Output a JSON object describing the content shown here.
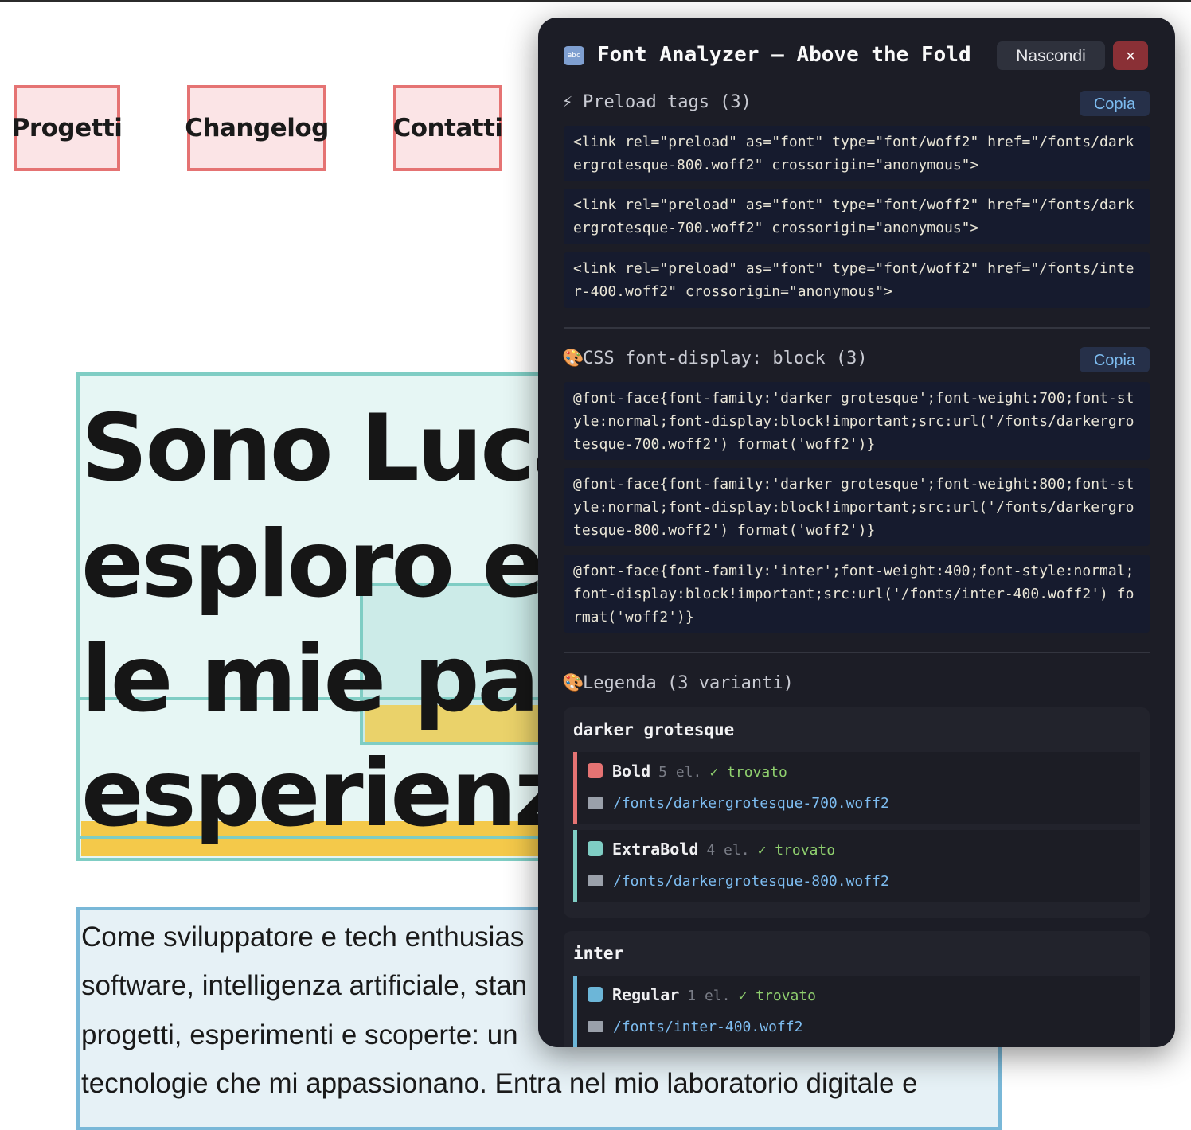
{
  "nav": {
    "items": [
      {
        "label": "Progetti"
      },
      {
        "label": "Changelog"
      },
      {
        "label": "Contatti"
      }
    ]
  },
  "hero": {
    "lines": [
      "Sono Luca",
      "esploro e c",
      "le mie pass",
      "esperienze"
    ]
  },
  "paragraph": {
    "lines": [
      "Come sviluppatore e tech enthusias",
      "software, intelligenza artificiale, stan",
      "progetti, esperimenti e scoperte: un",
      "tecnologie che mi appassionano. Entra nel mio laboratorio digitale e"
    ]
  },
  "panel": {
    "icon_text": "abc",
    "title": "Font Analyzer — Above the Fold",
    "hide_label": "Nascondi",
    "close_label": "×",
    "preload": {
      "title": "Preload tags (3)",
      "copy_label": "Copia",
      "icon": "lightning-icon",
      "tags": [
        {
          "l1": "<link rel=\"preload\" as=\"font\" type=\"font/woff2\" href=\"/fonts/dark",
          "l2": "ergrotesque-800.woff2\" crossorigin=\"anonymous\">"
        },
        {
          "l1": "<link rel=\"preload\" as=\"font\" type=\"font/woff2\" href=\"/fonts/dark",
          "l2": "ergrotesque-700.woff2\" crossorigin=\"anonymous\">"
        },
        {
          "l1": "<link rel=\"preload\" as=\"font\" type=\"font/woff2\" href=\"/fonts/inte",
          "l2": "r-400.woff2\" crossorigin=\"anonymous\">"
        }
      ]
    },
    "css": {
      "title": "CSS font-display: block (3)",
      "copy_label": "Copia",
      "icon": "palette-icon",
      "rules": [
        {
          "l1": "@font-face{font-family:'darker grotesque';font-weight:700;font-st",
          "l2": "yle:normal;font-display:block!important;src:url('/fonts/darkergro",
          "l3": "tesque-700.woff2') format('woff2')}"
        },
        {
          "l1": "@font-face{font-family:'darker grotesque';font-weight:800;font-st",
          "l2": "yle:normal;font-display:block!important;src:url('/fonts/darkergro",
          "l3": "tesque-800.woff2') format('woff2')}"
        },
        {
          "l1": "@font-face{font-family:'inter';font-weight:400;font-style:normal;",
          "l2": "font-display:block!important;src:url('/fonts/inter-400.woff2') fo",
          "l3": "rmat('woff2')}"
        }
      ]
    },
    "legend": {
      "title": "Legenda (3 varianti)",
      "icon": "palette-icon",
      "groups": [
        {
          "name": "darker grotesque",
          "variants": [
            {
              "name": "Bold",
              "count": "5 el.",
              "status": "✓ trovato",
              "path": "/fonts/darkergrotesque-700.woff2",
              "color": "#e57373"
            },
            {
              "name": "ExtraBold",
              "count": "4 el.",
              "status": "✓ trovato",
              "path": "/fonts/darkergrotesque-800.woff2",
              "color": "#7fcdc4"
            }
          ]
        },
        {
          "name": "inter",
          "variants": [
            {
              "name": "Regular",
              "count": "1 el.",
              "status": "✓ trovato",
              "path": "/fonts/inter-400.woff2",
              "color": "#6cb6d8"
            }
          ]
        }
      ]
    }
  },
  "colors": {
    "nav_border": "#e57373",
    "hero_border": "#7fcdc4",
    "para_border": "#79b8d8",
    "panel_bg": "#1c1d26",
    "accent_blue": "#7dbcf0",
    "found_green": "#8fcf6e"
  }
}
